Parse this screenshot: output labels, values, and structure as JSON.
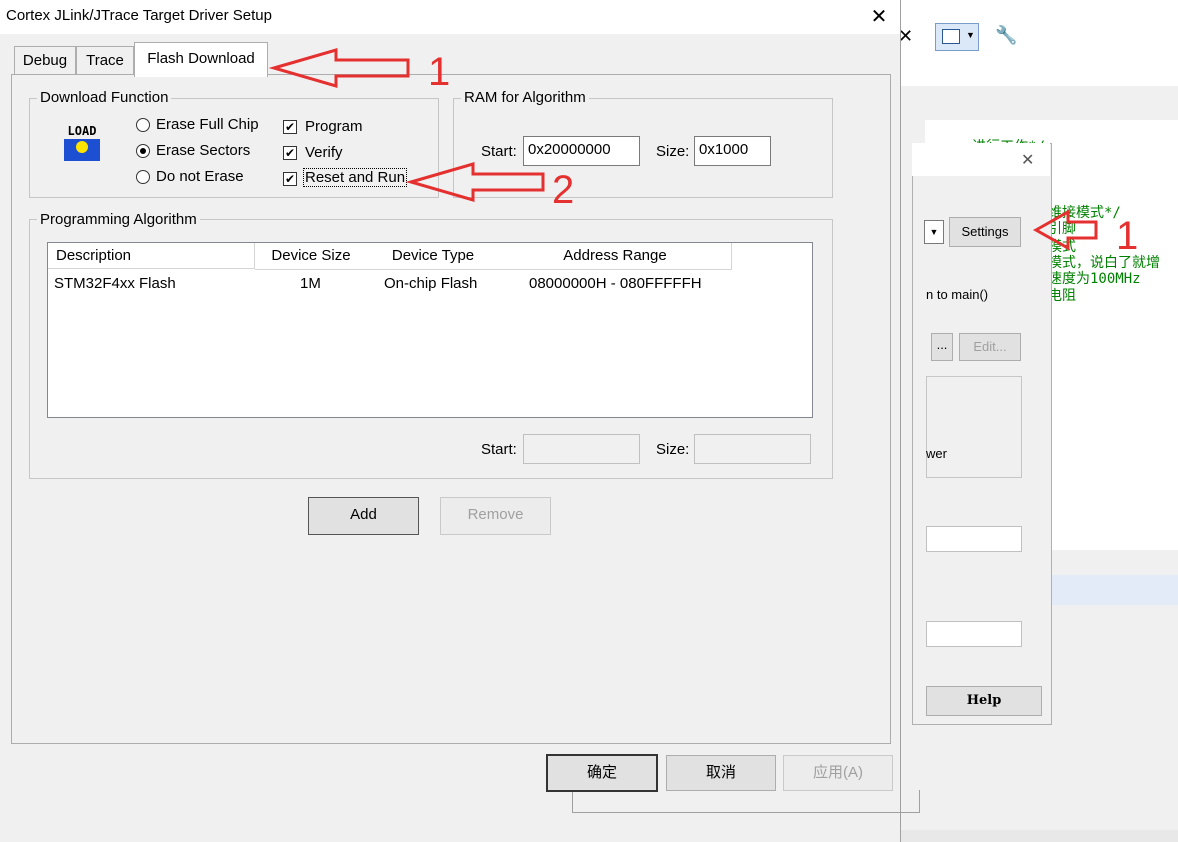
{
  "dialog": {
    "title": "Cortex JLink/JTrace Target Driver Setup",
    "tabs": [
      "Debug",
      "Trace",
      "Flash Download"
    ],
    "download_function": {
      "legend": "Download Function",
      "icon_text": "LOAD",
      "erase_options": [
        "Erase Full Chip",
        "Erase Sectors",
        "Do not Erase"
      ],
      "selected_erase": "Erase Sectors",
      "checks": [
        {
          "label": "Program",
          "checked": true
        },
        {
          "label": "Verify",
          "checked": true
        },
        {
          "label": "Reset and Run",
          "checked": true
        }
      ]
    },
    "ram": {
      "legend": "RAM for Algorithm",
      "start_label": "Start:",
      "start_value": "0x20000000",
      "size_label": "Size:",
      "size_value": "0x1000"
    },
    "programming": {
      "legend": "Programming Algorithm",
      "columns": [
        "Description",
        "Device Size",
        "Device Type",
        "Address Range"
      ],
      "rows": [
        [
          "STM32F4xx Flash",
          "1M",
          "On-chip Flash",
          "08000000H - 080FFFFFH"
        ]
      ],
      "start_label": "Start:",
      "size_label": "Size:"
    },
    "add_label": "Add",
    "remove_label": "Remove",
    "ok_label": "确定",
    "cancel_label": "取消",
    "apply_label": "应用(A)"
  },
  "background": {
    "settings_label": "Settings",
    "run_to_main_text": "n to main()",
    "dots_label": "...",
    "edit_label": "Edit...",
    "wer_text": "wer",
    "help_label": "Help",
    "code_lines": [
      "oneze进行工作*/",
      "维接模式*/",
      "引脚",
      "模式",
      "模式，说白了就增",
      "速度为100MHz",
      "电阻"
    ]
  },
  "annotations": {
    "arrow1_label": "1",
    "arrow2_label": "2",
    "arrow3_label": "1",
    "color": "#e53030"
  }
}
